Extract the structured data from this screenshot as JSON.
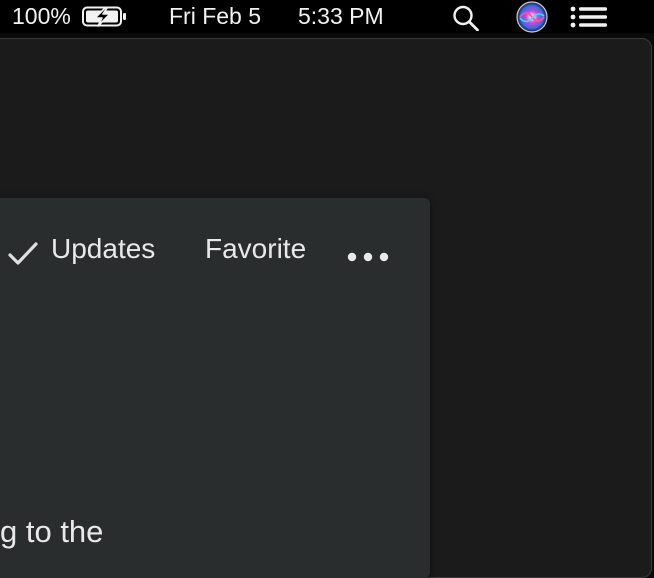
{
  "menubar": {
    "battery_percent": "100%",
    "battery_icon": "battery-charging-icon",
    "date": "Fri Feb 5",
    "time": "5:33 PM",
    "search_icon": "spotlight-search-icon",
    "siri_icon": "siri-icon",
    "list_icon": "notification-center-icon"
  },
  "panel": {
    "updates_label": "Updates",
    "updates_checked": true,
    "favorite_label": "Favorite",
    "more_icon": "more-ellipsis-icon",
    "body_text_fragment": "g to the"
  },
  "colors": {
    "menubar_bg": "#000000",
    "window_bg": "#1b1b1c",
    "panel_bg": "#2a2d2e",
    "text": "#e9e9e9"
  }
}
